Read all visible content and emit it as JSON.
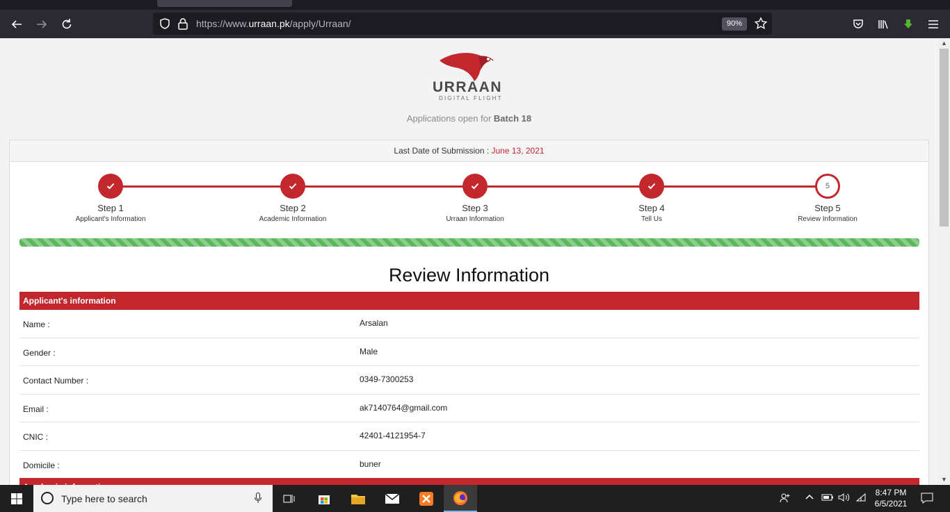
{
  "browser": {
    "url_prefix": "https://www.",
    "url_domain": "urraan.pk",
    "url_path": "/apply/Urraan/",
    "zoom": "90%"
  },
  "header": {
    "logo_word": "URRAAN",
    "logo_sub": "DIGITAL FLIGHT",
    "batch_prefix": "Applications open for",
    "batch_value": "Batch 18"
  },
  "deadline": {
    "label": "Last Date of Submission :",
    "date": "June 13, 2021"
  },
  "steps": [
    {
      "title": "Step 1",
      "label": "Applicant's Information",
      "done": true
    },
    {
      "title": "Step 2",
      "label": "Academic Information",
      "done": true
    },
    {
      "title": "Step 3",
      "label": "Urraan Information",
      "done": true
    },
    {
      "title": "Step 4",
      "label": "Tell Us",
      "done": true
    },
    {
      "title": "Step 5",
      "label": "Review Information",
      "done": false,
      "number": "5"
    }
  ],
  "progress_percent": 100,
  "review": {
    "title": "Review Information",
    "applicant_section": "Applicant's information",
    "academic_section": "Academic information",
    "fields": [
      {
        "label": "Name :",
        "value": "Arsalan"
      },
      {
        "label": "Gender :",
        "value": "Male"
      },
      {
        "label": "Contact Number :",
        "value": "0349-7300253"
      },
      {
        "label": "Email :",
        "value": "ak7140764@gmail.com"
      },
      {
        "label": "CNIC :",
        "value": "42401-4121954-7"
      },
      {
        "label": "Domicile :",
        "value": "buner"
      }
    ]
  },
  "taskbar": {
    "search_placeholder": "Type here to search",
    "time": "8:47 PM",
    "date": "6/5/2021"
  },
  "colors": {
    "brand_red": "#c1272d",
    "progress_green": "#5cb85c"
  }
}
